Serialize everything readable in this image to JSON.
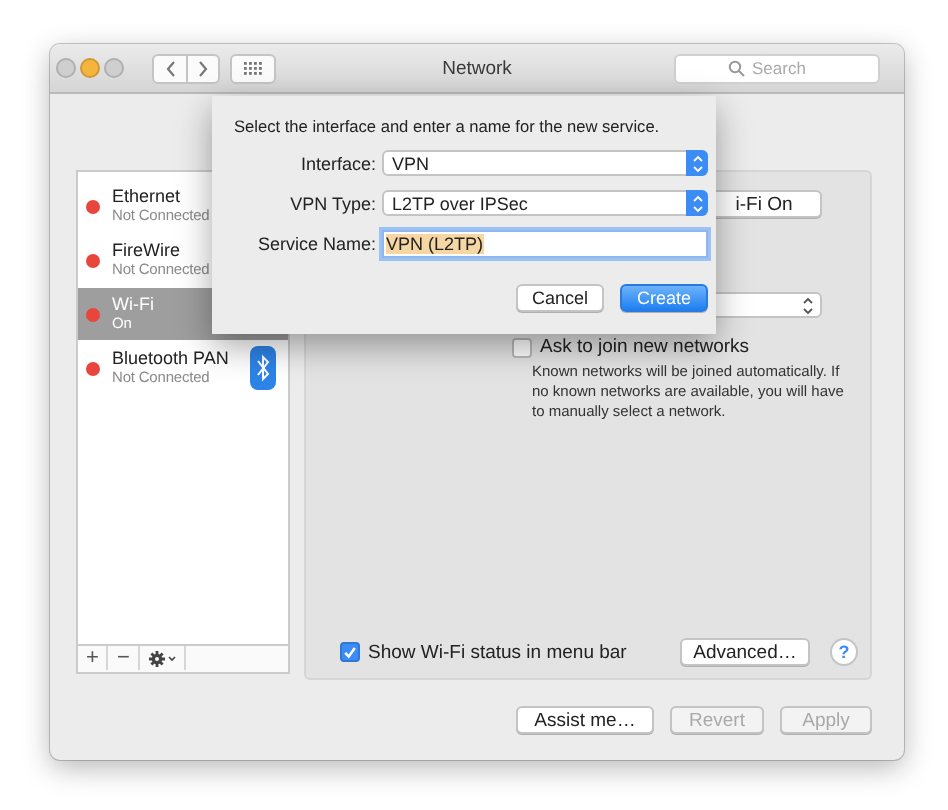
{
  "window": {
    "title": "Network",
    "search": {
      "placeholder": "Search"
    }
  },
  "services": [
    {
      "name": "Ethernet",
      "status": "Not Connected",
      "color": "#e8453c",
      "selected": false,
      "kind": "plain"
    },
    {
      "name": "FireWire",
      "status": "Not Connected",
      "color": "#e8453c",
      "selected": false,
      "kind": "plain"
    },
    {
      "name": "Wi-Fi",
      "status": "On",
      "color": "#e8453c",
      "selected": true,
      "kind": "plain"
    },
    {
      "name": "Bluetooth PAN",
      "status": "Not Connected",
      "color": "#e8453c",
      "selected": false,
      "kind": "bluetooth"
    }
  ],
  "sidebar_toolbar": {
    "add": "+",
    "remove": "−"
  },
  "panel": {
    "partial_button": "i-Fi On",
    "ask_to_join": {
      "label": "Ask to join new networks",
      "checked": false
    },
    "ask_note": "Known networks will be joined automatically. If no known networks are available, you will have to manually select a network.",
    "show_status": {
      "label": "Show Wi-Fi status in menu bar",
      "checked": true
    },
    "advanced_button": "Advanced…",
    "help": "?"
  },
  "buttons": [
    {
      "label": "Assist me…",
      "disabled": false
    },
    {
      "label": "Revert",
      "disabled": true
    },
    {
      "label": "Apply",
      "disabled": true
    }
  ],
  "sheet": {
    "prompt": "Select the interface and enter a name for the new service.",
    "fields": [
      {
        "kind": "popup",
        "label": "Interface:",
        "value": "VPN"
      },
      {
        "kind": "popup",
        "label": "VPN Type:",
        "value": "L2TP over IPSec"
      },
      {
        "kind": "text",
        "label": "Service Name:",
        "value": "VPN (L2TP)",
        "text_selected": true
      }
    ],
    "buttons": [
      {
        "label": "Cancel",
        "default": false
      },
      {
        "label": "Create",
        "default": true
      }
    ]
  }
}
